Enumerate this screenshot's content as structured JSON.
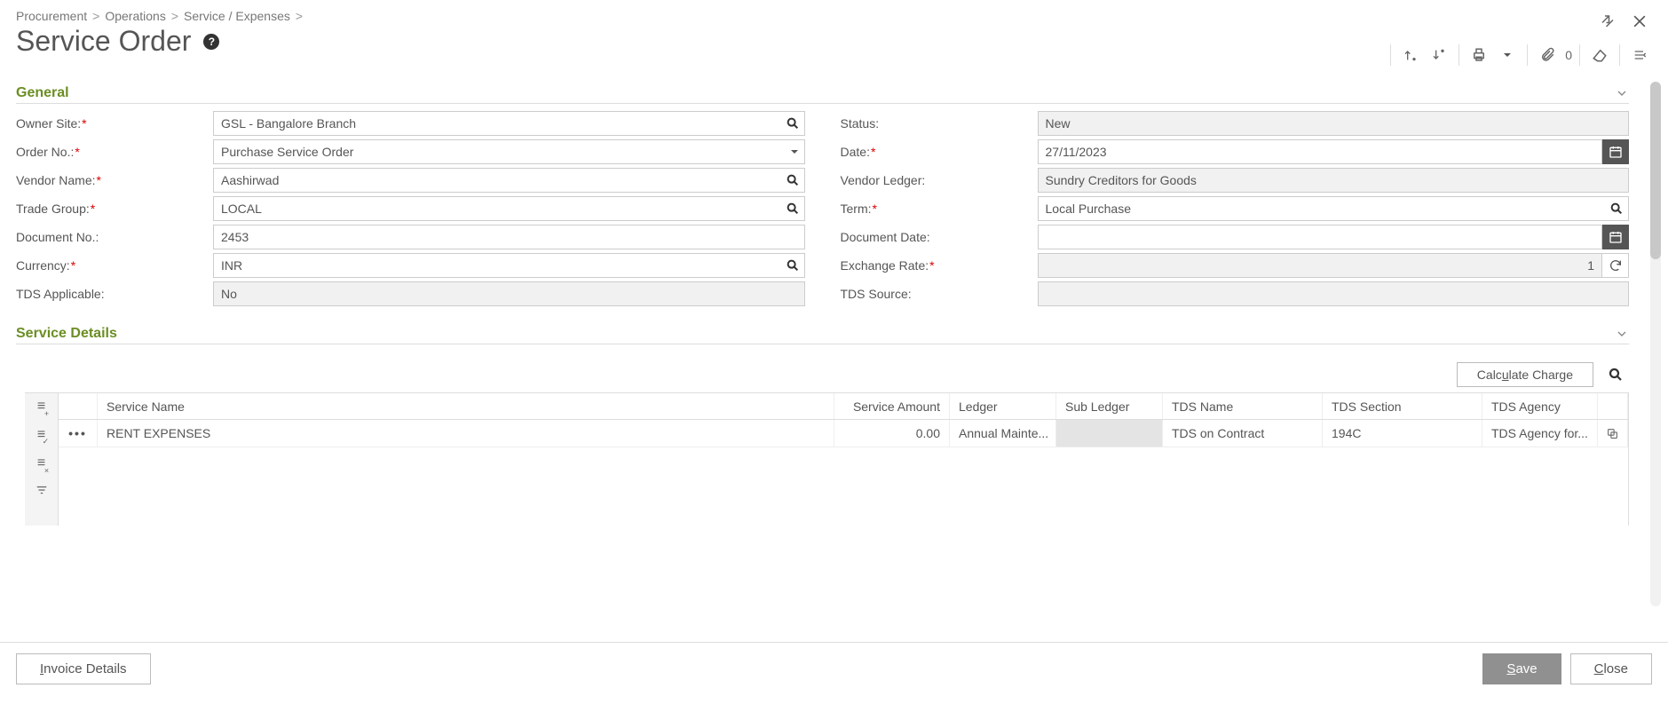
{
  "breadcrumb": {
    "a": "Procurement",
    "b": "Operations",
    "c": "Service / Expenses"
  },
  "page_title": "Service Order",
  "toolbar": {
    "attach_count": "0"
  },
  "sections": {
    "general": "General",
    "service_details": "Service Details"
  },
  "labels": {
    "owner_site": "Owner Site:",
    "order_no": "Order No.:",
    "vendor_name": "Vendor Name:",
    "trade_group": "Trade Group:",
    "document_no": "Document No.:",
    "currency": "Currency:",
    "tds_applicable": "TDS Applicable:",
    "status": "Status:",
    "date": "Date:",
    "vendor_ledger": "Vendor Ledger:",
    "term": "Term:",
    "document_date": "Document Date:",
    "exchange_rate": "Exchange Rate:",
    "tds_source": "TDS Source:"
  },
  "fields": {
    "owner_site": "GSL - Bangalore Branch",
    "order_no": "Purchase Service Order",
    "vendor_name": "Aashirwad",
    "trade_group": "LOCAL",
    "document_no": "2453",
    "currency": "INR",
    "tds_applicable": "No",
    "status": "New",
    "date": "27/11/2023",
    "vendor_ledger": "Sundry Creditors for Goods",
    "term": "Local Purchase",
    "document_date": "",
    "exchange_rate": "1",
    "tds_source": ""
  },
  "service": {
    "calc_btn": "Calculate Charge",
    "headers": {
      "name": "Service Name",
      "amount": "Service Amount",
      "ledger": "Ledger",
      "subledger": "Sub Ledger",
      "tds_name": "TDS Name",
      "tds_section": "TDS Section",
      "tds_agency": "TDS Agency"
    },
    "rows": [
      {
        "name": "RENT EXPENSES",
        "amount": "0.00",
        "ledger": "Annual Mainte...",
        "subledger": "",
        "tds_name": "TDS on Contract",
        "tds_section": "194C",
        "tds_agency": "TDS Agency for..."
      }
    ]
  },
  "footer": {
    "invoice": "Invoice Details",
    "save": "Save",
    "close": "Close"
  }
}
